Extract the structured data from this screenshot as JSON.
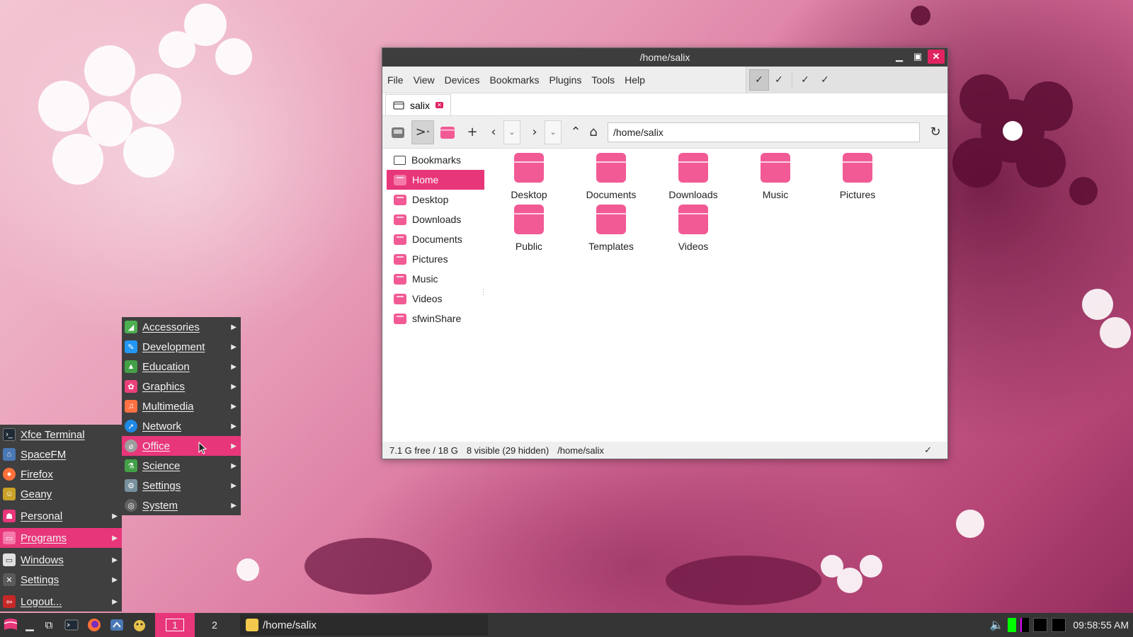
{
  "window": {
    "title": "/home/salix",
    "menus": [
      "File",
      "View",
      "Devices",
      "Bookmarks",
      "Plugins",
      "Tools",
      "Help"
    ],
    "tab_label": "salix",
    "path": "/home/salix",
    "sidebar": [
      {
        "label": "Bookmarks",
        "icon": "bookmarks-icon"
      },
      {
        "label": "Home",
        "icon": "folder-icon",
        "active": true
      },
      {
        "label": "Desktop",
        "icon": "folder-icon"
      },
      {
        "label": "Downloads",
        "icon": "folder-icon"
      },
      {
        "label": "Documents",
        "icon": "folder-icon"
      },
      {
        "label": "Pictures",
        "icon": "folder-icon"
      },
      {
        "label": "Music",
        "icon": "folder-icon"
      },
      {
        "label": "Videos",
        "icon": "folder-icon"
      },
      {
        "label": "sfwinShare",
        "icon": "folder-icon"
      }
    ],
    "files": [
      "Desktop",
      "Documents",
      "Downloads",
      "Music",
      "Pictures",
      "Public",
      "Templates",
      "Videos"
    ],
    "status": {
      "free": "7.1 G free / 18 G",
      "visible": "8 visible (29 hidden)",
      "path": "/home/salix"
    }
  },
  "start_menu": {
    "favorites": [
      {
        "label": "Xfce Terminal",
        "icon": "terminal-icon"
      },
      {
        "label": "SpaceFM",
        "icon": "spacefm-icon"
      },
      {
        "label": "Firefox",
        "icon": "firefox-icon"
      },
      {
        "label": "Geany",
        "icon": "geany-icon"
      }
    ],
    "groups": [
      {
        "label": "Personal",
        "icon": "personal-icon"
      },
      {
        "label": "Programs",
        "icon": "programs-icon",
        "active": true
      },
      {
        "label": "Windows",
        "icon": "windows-icon"
      },
      {
        "label": "Settings",
        "icon": "settings-icon"
      },
      {
        "label": "Logout...",
        "icon": "logout-icon"
      }
    ]
  },
  "programs_menu": [
    {
      "label": "Accessories",
      "icon": "accessories-icon",
      "color": "#4caf50"
    },
    {
      "label": "Development",
      "icon": "development-icon",
      "color": "#2196f3"
    },
    {
      "label": "Education",
      "icon": "education-icon",
      "color": "#43a047"
    },
    {
      "label": "Graphics",
      "icon": "graphics-icon",
      "color": "#ec407a"
    },
    {
      "label": "Multimedia",
      "icon": "multimedia-icon",
      "color": "#ff7043"
    },
    {
      "label": "Network",
      "icon": "network-icon",
      "color": "#1e88e5"
    },
    {
      "label": "Office",
      "icon": "office-icon",
      "color": "#9e9e9e",
      "active": true
    },
    {
      "label": "Science",
      "icon": "science-icon",
      "color": "#43a047"
    },
    {
      "label": "Settings",
      "icon": "settings-icon",
      "color": "#78909c"
    },
    {
      "label": "System",
      "icon": "system-icon",
      "color": "#616161"
    }
  ],
  "panel": {
    "workspaces": [
      "1",
      "2"
    ],
    "task_label": "/home/salix",
    "clock": "09:58:55 AM"
  },
  "colors": {
    "accent": "#e8367a",
    "folder": "#f25a95",
    "panel": "#353535",
    "menu": "#3f3f3f"
  }
}
